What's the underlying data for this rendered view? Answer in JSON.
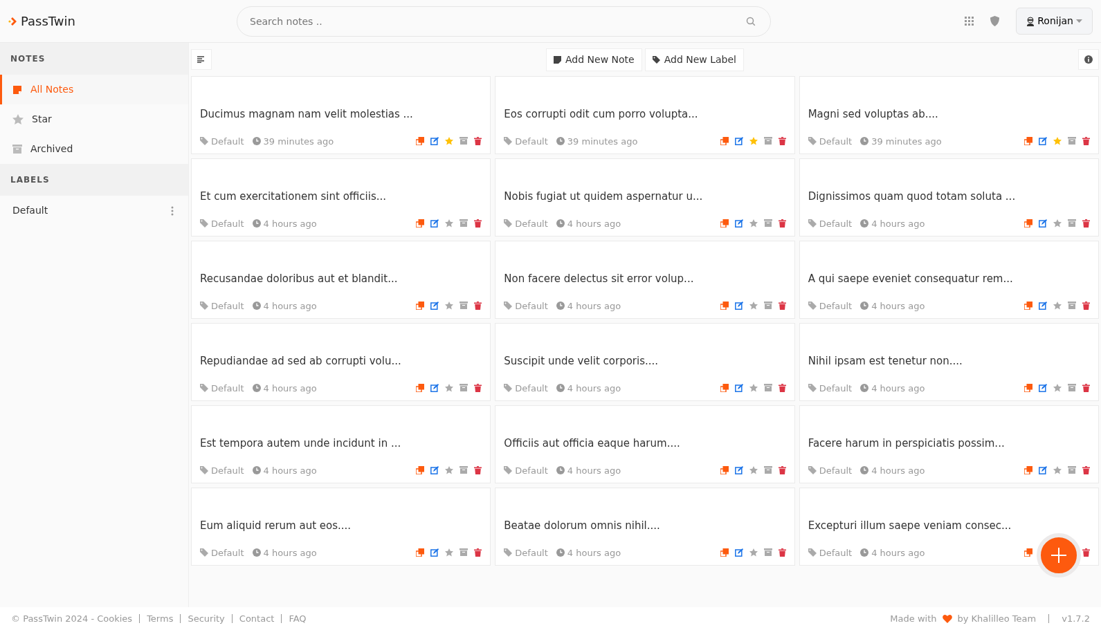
{
  "brand": "PassTwin",
  "search": {
    "placeholder": "Search notes .."
  },
  "user": {
    "name": "Ronijan"
  },
  "sidebar": {
    "sections": [
      {
        "title": "NOTES",
        "items": [
          {
            "label": "All Notes",
            "kind": "notes",
            "selected": true
          },
          {
            "label": "Star",
            "kind": "star",
            "selected": false
          },
          {
            "label": "Archived",
            "kind": "archive",
            "selected": false
          }
        ]
      },
      {
        "title": "LABELS",
        "items": [
          {
            "label": "Default",
            "kind": "label",
            "selected": false
          }
        ]
      }
    ]
  },
  "toolbar": {
    "buttons": [
      {
        "label": "Add New Note",
        "kind": "note"
      },
      {
        "label": "Add New Label",
        "kind": "tag"
      }
    ]
  },
  "notes": [
    {
      "title": "Ducimus magnam nam velit molestias ...",
      "label": "Default",
      "time": "39 minutes ago",
      "starred": true
    },
    {
      "title": "Eos corrupti odit cum porro volupta...",
      "label": "Default",
      "time": "39 minutes ago",
      "starred": true
    },
    {
      "title": "Magni sed voluptas ab....",
      "label": "Default",
      "time": "39 minutes ago",
      "starred": true
    },
    {
      "title": "Et cum exercitationem sint officiis...",
      "label": "Default",
      "time": "4 hours ago",
      "starred": false
    },
    {
      "title": "Nobis fugiat ut quidem aspernatur u...",
      "label": "Default",
      "time": "4 hours ago",
      "starred": false
    },
    {
      "title": "Dignissimos quam quod totam soluta ...",
      "label": "Default",
      "time": "4 hours ago",
      "starred": false
    },
    {
      "title": "Recusandae doloribus aut et blandit...",
      "label": "Default",
      "time": "4 hours ago",
      "starred": false
    },
    {
      "title": "Non facere delectus sit error volup...",
      "label": "Default",
      "time": "4 hours ago",
      "starred": false
    },
    {
      "title": "A qui saepe eveniet consequatur rem...",
      "label": "Default",
      "time": "4 hours ago",
      "starred": false
    },
    {
      "title": "Repudiandae ad sed ab corrupti volu...",
      "label": "Default",
      "time": "4 hours ago",
      "starred": false
    },
    {
      "title": "Suscipit unde velit corporis....",
      "label": "Default",
      "time": "4 hours ago",
      "starred": false
    },
    {
      "title": "Nihil ipsam est tenetur non....",
      "label": "Default",
      "time": "4 hours ago",
      "starred": false
    },
    {
      "title": "Est tempora autem unde incidunt in ...",
      "label": "Default",
      "time": "4 hours ago",
      "starred": false
    },
    {
      "title": "Officiis aut officia eaque harum....",
      "label": "Default",
      "time": "4 hours ago",
      "starred": false
    },
    {
      "title": "Facere harum in perspiciatis possim...",
      "label": "Default",
      "time": "4 hours ago",
      "starred": false
    },
    {
      "title": "Eum aliquid rerum aut eos....",
      "label": "Default",
      "time": "4 hours ago",
      "starred": false
    },
    {
      "title": "Beatae dolorum omnis nihil....",
      "label": "Default",
      "time": "4 hours ago",
      "starred": false
    },
    {
      "title": "Excepturi illum saepe veniam consec...",
      "label": "Default",
      "time": "4 hours ago"
    }
  ],
  "footer": {
    "copyright": "© PassTwin 2024 -",
    "links": [
      "Cookies",
      "Terms",
      "Security",
      "Contact",
      "FAQ"
    ],
    "made_with": "Made with",
    "by": "by Khalilleo Team",
    "version": "v1.7.2"
  }
}
